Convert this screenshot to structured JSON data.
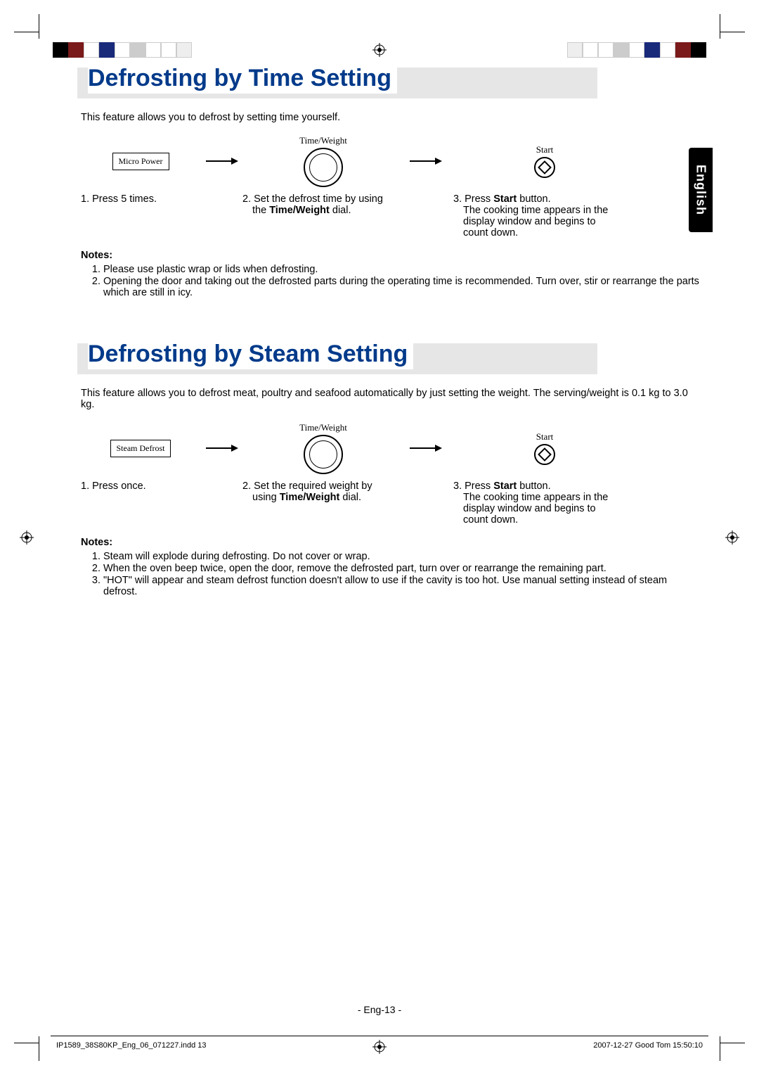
{
  "language_tab": "English",
  "section1": {
    "title": "Defrosting by Time Setting",
    "intro": "This feature allows you to defrost by setting time yourself.",
    "dial_label": "Time/Weight",
    "start_label": "Start",
    "button_label": "Micro Power",
    "step1": "1. Press 5 times.",
    "step2_line1": "2. Set the defrost time by using",
    "step2_line2": "the Time/Weight dial.",
    "step3_line1": "3. Press Start button.",
    "step3_line2": "The cooking time appears in the display window and begins to count down.",
    "notes_h": "Notes:",
    "note1": "Please use plastic wrap or lids when defrosting.",
    "note2": "Opening the door and taking out the defrosted parts during the operating time is recommended. Turn over, stir or rearrange the parts which are still in icy."
  },
  "section2": {
    "title": "Defrosting by Steam Setting",
    "intro": "This feature allows you to defrost meat, poultry and seafood automatically by just setting the weight. The serving/weight is 0.1 kg to 3.0 kg.",
    "dial_label": "Time/Weight",
    "start_label": "Start",
    "button_label": "Steam Defrost",
    "step1": "1. Press once.",
    "step2_line1": "2. Set the required weight by",
    "step2_line2": "using Time/Weight dial.",
    "step3_line1": "3. Press Start button.",
    "step3_line2": "The cooking time appears in the display window and begins to count down.",
    "notes_h": "Notes:",
    "note1": "Steam will explode during defrosting. Do not cover or wrap.",
    "note2": "When the oven beep twice, open the door, remove the defrosted part, turn over or rearrange the remaining part.",
    "note3": "\"HOT\" will appear and steam defrost function doesn't allow to use if the cavity is too hot. Use manual setting instead of steam defrost."
  },
  "page_number": "- Eng-13 -",
  "footer_left": "IP1589_38S80KP_Eng_06_071227.indd   13",
  "footer_right": "2007-12-27   Good Tom 15:50:10"
}
